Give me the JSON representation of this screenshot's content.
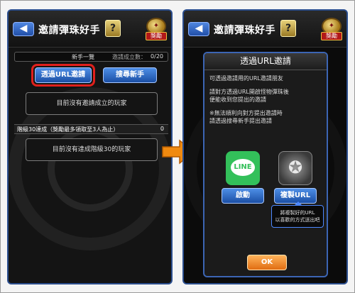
{
  "left_screen": {
    "back_icon": "back-arrow-icon",
    "title": "邀請彈珠好手",
    "help_label": "?",
    "reward_tag": "獎勵",
    "list_title": "新手一覽",
    "invite_count_label": "邀請成立數：",
    "invite_count_value": "0/20",
    "url_invite_button": "透過URL邀請",
    "search_button": "搜尋新手",
    "no_invite_text": "目前沒有邀請成立的玩家",
    "section_label": "階級30達成（獎勵最多領取至3人為止）",
    "section_count": "0",
    "no_rank_text": "目前沒有達成階級30的玩家"
  },
  "right_screen": {
    "title": "邀請彈珠好手",
    "help_label": "?",
    "reward_tag": "獎勵",
    "dialog_title": "透過URL邀請",
    "line1": "可透過邀請用的URL邀請朋友",
    "line2": "請對方透過URL開啟怪物彈珠後",
    "line3": "便能收到您提出的邀請",
    "note1": "※無法順利向對方提出邀請時",
    "note2": "請透過搜尋新手提出邀請",
    "line_icon_text": "LINE",
    "launch_button": "啟動",
    "copy_url_button": "複製URL",
    "tip_line1": "將複製好的URL",
    "tip_line2": "以喜歡的方式送出吧",
    "ok_button": "OK"
  },
  "colors": {
    "accent_blue": "#1b4fa5",
    "highlight_red": "#e0201c",
    "arrow_orange": "#f08a10",
    "line_green": "#33c05a",
    "ok_orange": "#e06d12"
  }
}
